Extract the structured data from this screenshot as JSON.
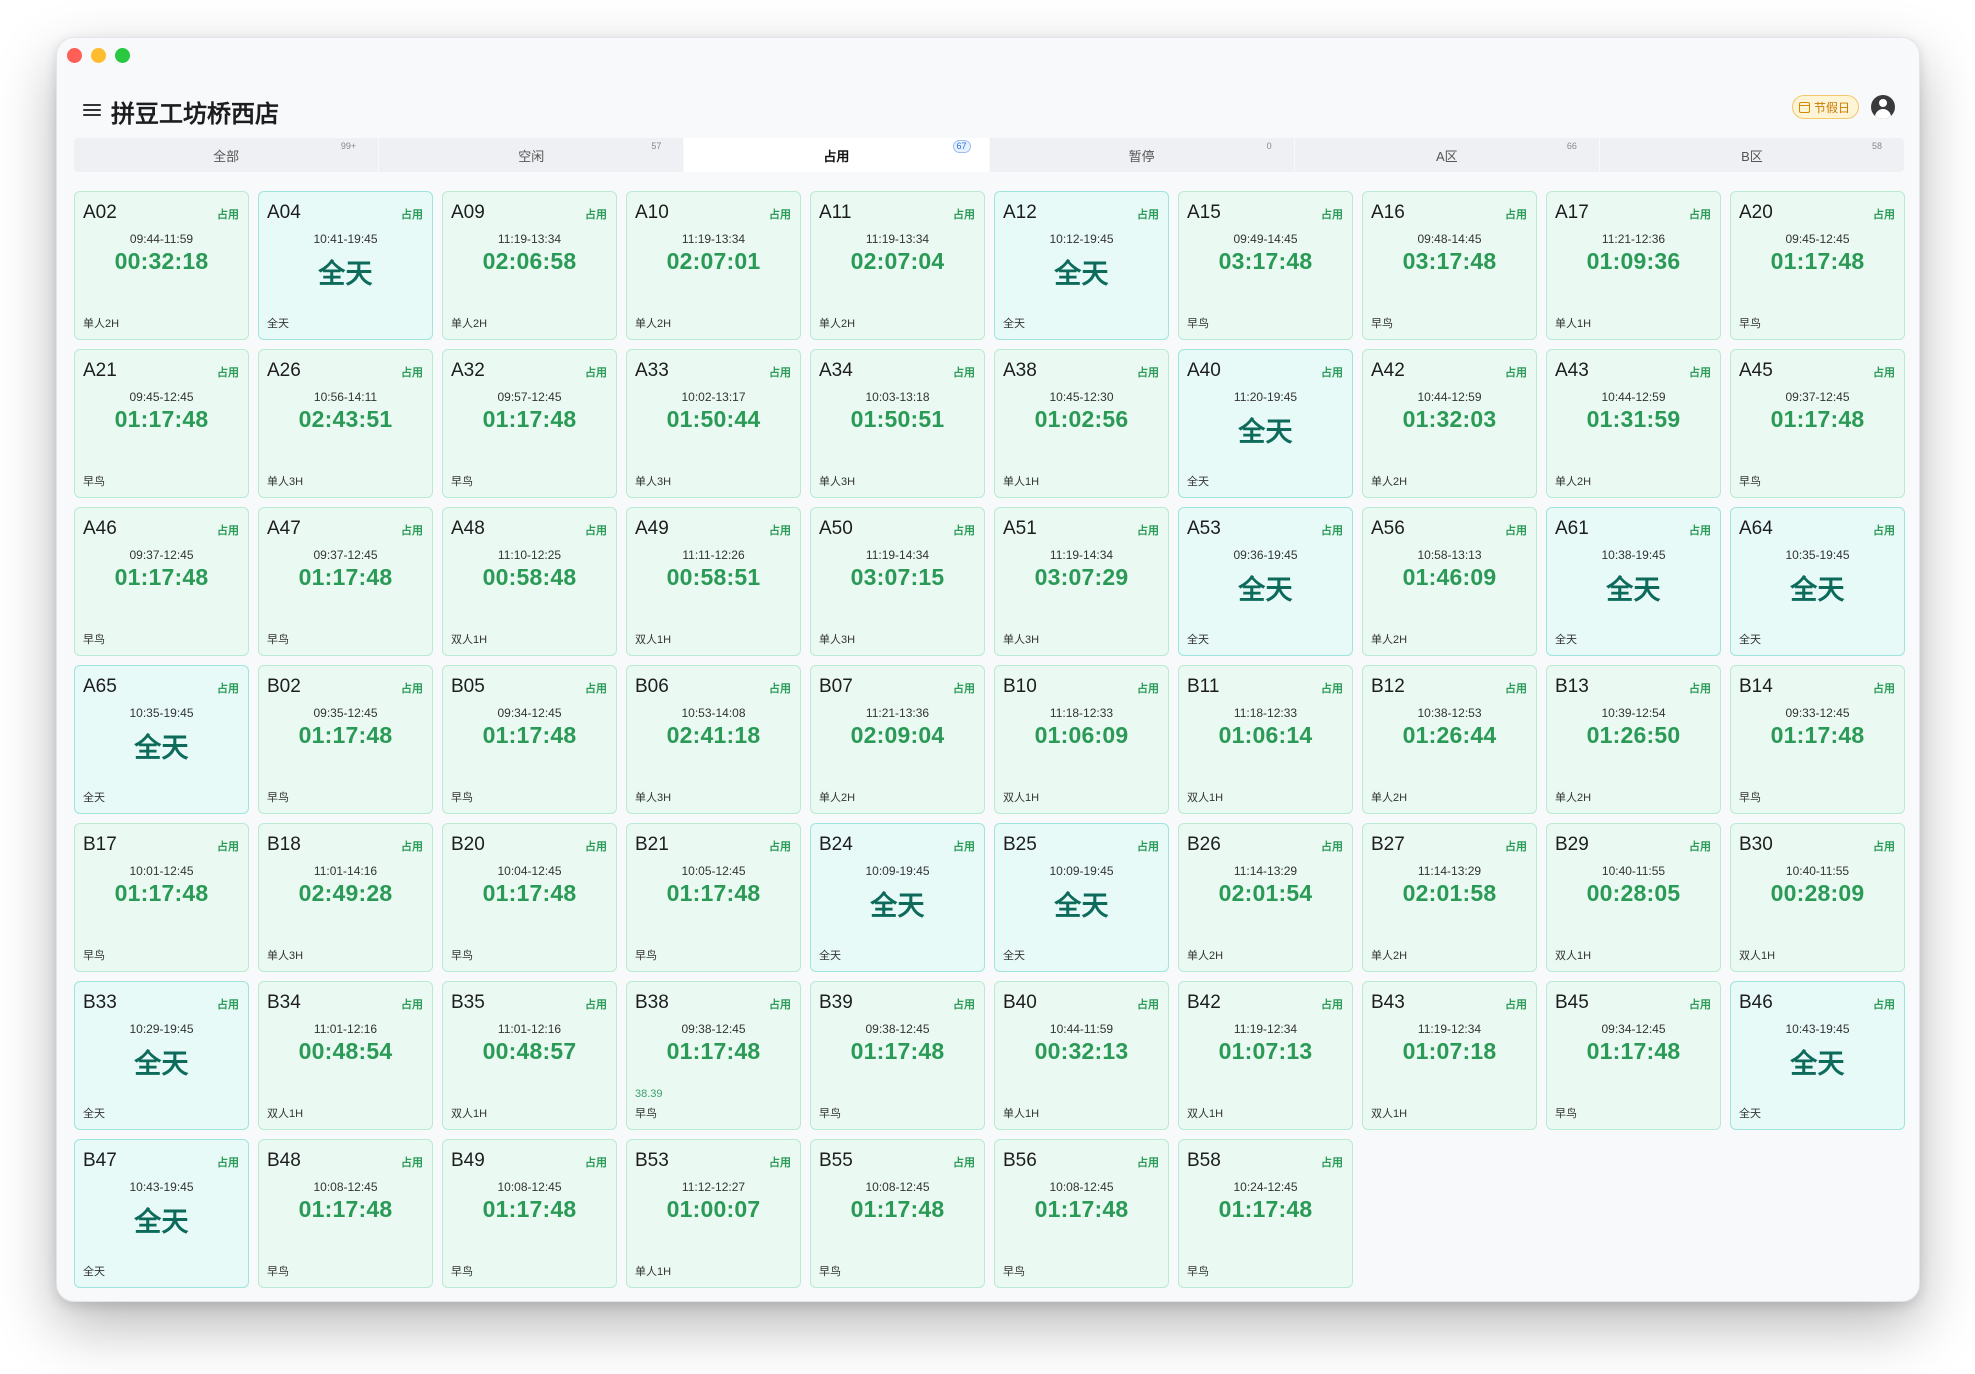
{
  "window": {
    "title": "拼豆工坊桥西店",
    "holiday_label": "节假日"
  },
  "tabs": [
    {
      "label": "全部",
      "count": "99+",
      "active": false
    },
    {
      "label": "空闲",
      "count": "57",
      "active": false
    },
    {
      "label": "占用",
      "count": "67",
      "active": true
    },
    {
      "label": "暂停",
      "count": "0",
      "active": false
    },
    {
      "label": "A区",
      "count": "66",
      "active": false
    },
    {
      "label": "B区",
      "count": "58",
      "active": false
    }
  ],
  "status_color": "#2e9b5a",
  "tables": [
    {
      "id": "A02",
      "status": "占用",
      "range": "09:44-11:59",
      "timer": "00:32:18",
      "package": "单人2H"
    },
    {
      "id": "A04",
      "status": "占用",
      "range": "10:41-19:45",
      "timer": "全天",
      "package": "全天"
    },
    {
      "id": "A09",
      "status": "占用",
      "range": "11:19-13:34",
      "timer": "02:06:58",
      "package": "单人2H"
    },
    {
      "id": "A10",
      "status": "占用",
      "range": "11:19-13:34",
      "timer": "02:07:01",
      "package": "单人2H"
    },
    {
      "id": "A11",
      "status": "占用",
      "range": "11:19-13:34",
      "timer": "02:07:04",
      "package": "单人2H"
    },
    {
      "id": "A12",
      "status": "占用",
      "range": "10:12-19:45",
      "timer": "全天",
      "package": "全天"
    },
    {
      "id": "A15",
      "status": "占用",
      "range": "09:49-14:45",
      "timer": "03:17:48",
      "package": "早鸟"
    },
    {
      "id": "A16",
      "status": "占用",
      "range": "09:48-14:45",
      "timer": "03:17:48",
      "package": "早鸟"
    },
    {
      "id": "A17",
      "status": "占用",
      "range": "11:21-12:36",
      "timer": "01:09:36",
      "package": "单人1H"
    },
    {
      "id": "A20",
      "status": "占用",
      "range": "09:45-12:45",
      "timer": "01:17:48",
      "package": "早鸟"
    },
    {
      "id": "A21",
      "status": "占用",
      "range": "09:45-12:45",
      "timer": "01:17:48",
      "package": "早鸟"
    },
    {
      "id": "A26",
      "status": "占用",
      "range": "10:56-14:11",
      "timer": "02:43:51",
      "package": "单人3H"
    },
    {
      "id": "A32",
      "status": "占用",
      "range": "09:57-12:45",
      "timer": "01:17:48",
      "package": "早鸟"
    },
    {
      "id": "A33",
      "status": "占用",
      "range": "10:02-13:17",
      "timer": "01:50:44",
      "package": "单人3H"
    },
    {
      "id": "A34",
      "status": "占用",
      "range": "10:03-13:18",
      "timer": "01:50:51",
      "package": "单人3H"
    },
    {
      "id": "A38",
      "status": "占用",
      "range": "10:45-12:30",
      "timer": "01:02:56",
      "package": "单人1H"
    },
    {
      "id": "A40",
      "status": "占用",
      "range": "11:20-19:45",
      "timer": "全天",
      "package": "全天"
    },
    {
      "id": "A42",
      "status": "占用",
      "range": "10:44-12:59",
      "timer": "01:32:03",
      "package": "单人2H"
    },
    {
      "id": "A43",
      "status": "占用",
      "range": "10:44-12:59",
      "timer": "01:31:59",
      "package": "单人2H"
    },
    {
      "id": "A45",
      "status": "占用",
      "range": "09:37-12:45",
      "timer": "01:17:48",
      "package": "早鸟"
    },
    {
      "id": "A46",
      "status": "占用",
      "range": "09:37-12:45",
      "timer": "01:17:48",
      "package": "早鸟"
    },
    {
      "id": "A47",
      "status": "占用",
      "range": "09:37-12:45",
      "timer": "01:17:48",
      "package": "早鸟"
    },
    {
      "id": "A48",
      "status": "占用",
      "range": "11:10-12:25",
      "timer": "00:58:48",
      "package": "双人1H"
    },
    {
      "id": "A49",
      "status": "占用",
      "range": "11:11-12:26",
      "timer": "00:58:51",
      "package": "双人1H"
    },
    {
      "id": "A50",
      "status": "占用",
      "range": "11:19-14:34",
      "timer": "03:07:15",
      "package": "单人3H"
    },
    {
      "id": "A51",
      "status": "占用",
      "range": "11:19-14:34",
      "timer": "03:07:29",
      "package": "单人3H"
    },
    {
      "id": "A53",
      "status": "占用",
      "range": "09:36-19:45",
      "timer": "全天",
      "package": "全天"
    },
    {
      "id": "A56",
      "status": "占用",
      "range": "10:58-13:13",
      "timer": "01:46:09",
      "package": "单人2H"
    },
    {
      "id": "A61",
      "status": "占用",
      "range": "10:38-19:45",
      "timer": "全天",
      "package": "全天"
    },
    {
      "id": "A64",
      "status": "占用",
      "range": "10:35-19:45",
      "timer": "全天",
      "package": "全天"
    },
    {
      "id": "A65",
      "status": "占用",
      "range": "10:35-19:45",
      "timer": "全天",
      "package": "全天"
    },
    {
      "id": "B02",
      "status": "占用",
      "range": "09:35-12:45",
      "timer": "01:17:48",
      "package": "早鸟"
    },
    {
      "id": "B05",
      "status": "占用",
      "range": "09:34-12:45",
      "timer": "01:17:48",
      "package": "早鸟"
    },
    {
      "id": "B06",
      "status": "占用",
      "range": "10:53-14:08",
      "timer": "02:41:18",
      "package": "单人3H"
    },
    {
      "id": "B07",
      "status": "占用",
      "range": "11:21-13:36",
      "timer": "02:09:04",
      "package": "单人2H"
    },
    {
      "id": "B10",
      "status": "占用",
      "range": "11:18-12:33",
      "timer": "01:06:09",
      "package": "双人1H"
    },
    {
      "id": "B11",
      "status": "占用",
      "range": "11:18-12:33",
      "timer": "01:06:14",
      "package": "双人1H"
    },
    {
      "id": "B12",
      "status": "占用",
      "range": "10:38-12:53",
      "timer": "01:26:44",
      "package": "单人2H"
    },
    {
      "id": "B13",
      "status": "占用",
      "range": "10:39-12:54",
      "timer": "01:26:50",
      "package": "单人2H"
    },
    {
      "id": "B14",
      "status": "占用",
      "range": "09:33-12:45",
      "timer": "01:17:48",
      "package": "早鸟"
    },
    {
      "id": "B17",
      "status": "占用",
      "range": "10:01-12:45",
      "timer": "01:17:48",
      "package": "早鸟"
    },
    {
      "id": "B18",
      "status": "占用",
      "range": "11:01-14:16",
      "timer": "02:49:28",
      "package": "单人3H"
    },
    {
      "id": "B20",
      "status": "占用",
      "range": "10:04-12:45",
      "timer": "01:17:48",
      "package": "早鸟"
    },
    {
      "id": "B21",
      "status": "占用",
      "range": "10:05-12:45",
      "timer": "01:17:48",
      "package": "早鸟"
    },
    {
      "id": "B24",
      "status": "占用",
      "range": "10:09-19:45",
      "timer": "全天",
      "package": "全天"
    },
    {
      "id": "B25",
      "status": "占用",
      "range": "10:09-19:45",
      "timer": "全天",
      "package": "全天"
    },
    {
      "id": "B26",
      "status": "占用",
      "range": "11:14-13:29",
      "timer": "02:01:54",
      "package": "单人2H"
    },
    {
      "id": "B27",
      "status": "占用",
      "range": "11:14-13:29",
      "timer": "02:01:58",
      "package": "单人2H"
    },
    {
      "id": "B29",
      "status": "占用",
      "range": "10:40-11:55",
      "timer": "00:28:05",
      "package": "双人1H"
    },
    {
      "id": "B30",
      "status": "占用",
      "range": "10:40-11:55",
      "timer": "00:28:09",
      "package": "双人1H"
    },
    {
      "id": "B33",
      "status": "占用",
      "range": "10:29-19:45",
      "timer": "全天",
      "package": "全天"
    },
    {
      "id": "B34",
      "status": "占用",
      "range": "11:01-12:16",
      "timer": "00:48:54",
      "package": "双人1H"
    },
    {
      "id": "B35",
      "status": "占用",
      "range": "11:01-12:16",
      "timer": "00:48:57",
      "package": "双人1H"
    },
    {
      "id": "B38",
      "status": "占用",
      "range": "09:38-12:45",
      "timer": "01:17:48",
      "price": "38.39",
      "package": "早鸟"
    },
    {
      "id": "B39",
      "status": "占用",
      "range": "09:38-12:45",
      "timer": "01:17:48",
      "package": "早鸟"
    },
    {
      "id": "B40",
      "status": "占用",
      "range": "10:44-11:59",
      "timer": "00:32:13",
      "package": "单人1H"
    },
    {
      "id": "B42",
      "status": "占用",
      "range": "11:19-12:34",
      "timer": "01:07:13",
      "package": "双人1H"
    },
    {
      "id": "B43",
      "status": "占用",
      "range": "11:19-12:34",
      "timer": "01:07:18",
      "package": "双人1H"
    },
    {
      "id": "B45",
      "status": "占用",
      "range": "09:34-12:45",
      "timer": "01:17:48",
      "package": "早鸟"
    },
    {
      "id": "B46",
      "status": "占用",
      "range": "10:43-19:45",
      "timer": "全天",
      "package": "全天"
    },
    {
      "id": "B47",
      "status": "占用",
      "range": "10:43-19:45",
      "timer": "全天",
      "package": "全天"
    },
    {
      "id": "B48",
      "status": "占用",
      "range": "10:08-12:45",
      "timer": "01:17:48",
      "package": "早鸟"
    },
    {
      "id": "B49",
      "status": "占用",
      "range": "10:08-12:45",
      "timer": "01:17:48",
      "package": "早鸟"
    },
    {
      "id": "B53",
      "status": "占用",
      "range": "11:12-12:27",
      "timer": "01:00:07",
      "package": "单人1H"
    },
    {
      "id": "B55",
      "status": "占用",
      "range": "10:08-12:45",
      "timer": "01:17:48",
      "package": "早鸟"
    },
    {
      "id": "B56",
      "status": "占用",
      "range": "10:08-12:45",
      "timer": "01:17:48",
      "package": "早鸟"
    },
    {
      "id": "B58",
      "status": "占用",
      "range": "10:24-12:45",
      "timer": "01:17:48",
      "package": "早鸟"
    }
  ]
}
